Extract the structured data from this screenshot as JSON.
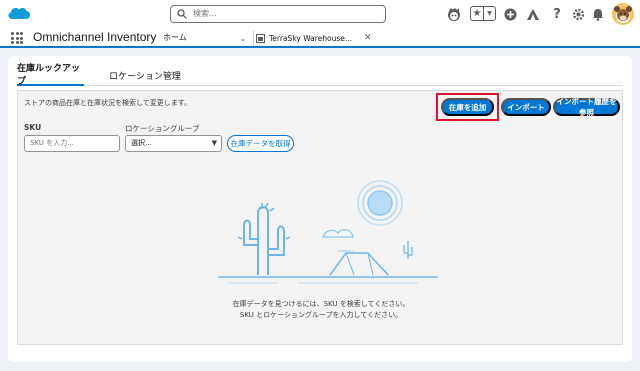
{
  "header": {
    "search_placeholder": "検索..."
  },
  "app": {
    "name": "Omnichannel Inventory",
    "tabs": [
      {
        "label": "ホーム"
      },
      {
        "label": "TerraSky Warehouse..."
      }
    ]
  },
  "page": {
    "tabs": [
      {
        "label": "在庫ルックアップ"
      },
      {
        "label": "ロケーション管理"
      }
    ],
    "description": "ストアの商品在庫と在庫状況を検索して変更します。",
    "buttons": {
      "add_inventory": "在庫を追加",
      "import": "インポート",
      "import_history": "インポート履歴を参照"
    },
    "sku": {
      "label": "SKU",
      "placeholder": "SKU を入力..."
    },
    "location_group": {
      "label": "ロケーショングループ",
      "value": "選択..."
    },
    "fetch_button": "在庫データを取得",
    "empty_message_line1": "在庫データを見つけるには、SKU を検索してください。",
    "empty_message_line2": "SKU とロケーショングループを入力してください。"
  },
  "colors": {
    "brand": "#0176d3",
    "highlight": "#e0132f",
    "page_bg": "#eef2f6"
  }
}
